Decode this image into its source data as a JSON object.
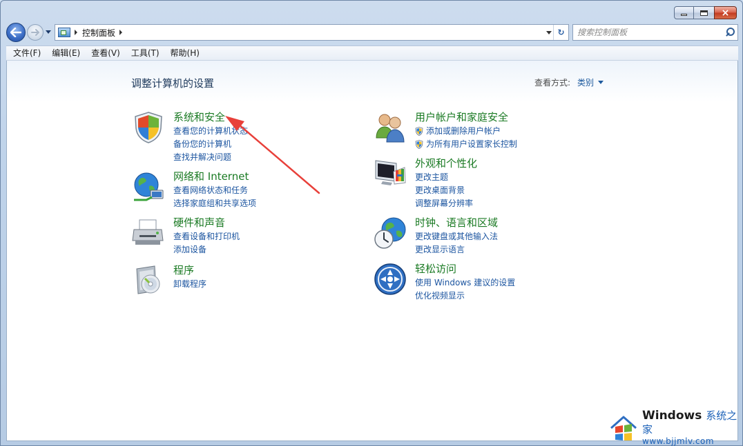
{
  "window": {
    "caption_buttons": {
      "minimize": "minimize-icon",
      "maximize": "maximize-icon",
      "close": "×"
    }
  },
  "navbar": {
    "breadcrumb": [
      "控制面板"
    ],
    "search_placeholder": "搜索控制面板",
    "refresh_glyph": "↻"
  },
  "menu": [
    "文件(F)",
    "编辑(E)",
    "查看(V)",
    "工具(T)",
    "帮助(H)"
  ],
  "content": {
    "title": "调整计算机的设置",
    "view_by_label": "查看方式:",
    "view_by_value": "类别",
    "categories": [
      {
        "title": "系统和安全",
        "icon": "shield-icon",
        "links": [
          "查看您的计算机状态",
          "备份您的计算机",
          "查找并解决问题"
        ]
      },
      {
        "title": "网络和 Internet",
        "icon": "network-globe-icon",
        "links": [
          "查看网络状态和任务",
          "选择家庭组和共享选项"
        ]
      },
      {
        "title": "硬件和声音",
        "icon": "printer-icon",
        "links": [
          "查看设备和打印机",
          "添加设备"
        ]
      },
      {
        "title": "程序",
        "icon": "programs-disc-icon",
        "links": [
          "卸载程序"
        ]
      },
      {
        "title": "用户帐户和家庭安全",
        "icon": "users-icon",
        "links": [
          "添加或删除用户帐户",
          "为所有用户设置家长控制"
        ]
      },
      {
        "title": "外观和个性化",
        "icon": "monitor-palette-icon",
        "links": [
          "更改主题",
          "更改桌面背景",
          "调整屏幕分辨率"
        ]
      },
      {
        "title": "时钟、语言和区域",
        "icon": "clock-globe-icon",
        "links": [
          "更改键盘或其他输入法",
          "更改显示语言"
        ]
      },
      {
        "title": "轻松访问",
        "icon": "ease-of-access-icon",
        "links": [
          "使用 Windows 建议的设置",
          "优化视频显示"
        ]
      }
    ]
  },
  "annotation": {
    "color": "#e8403a"
  },
  "watermark": {
    "brand": "Windows",
    "suffix": "系统之家",
    "url": "www.bjjmlv.com"
  },
  "colors": {
    "category_title": "#1a7a23",
    "link": "#1c55a0",
    "accent": "#1d62b8"
  }
}
